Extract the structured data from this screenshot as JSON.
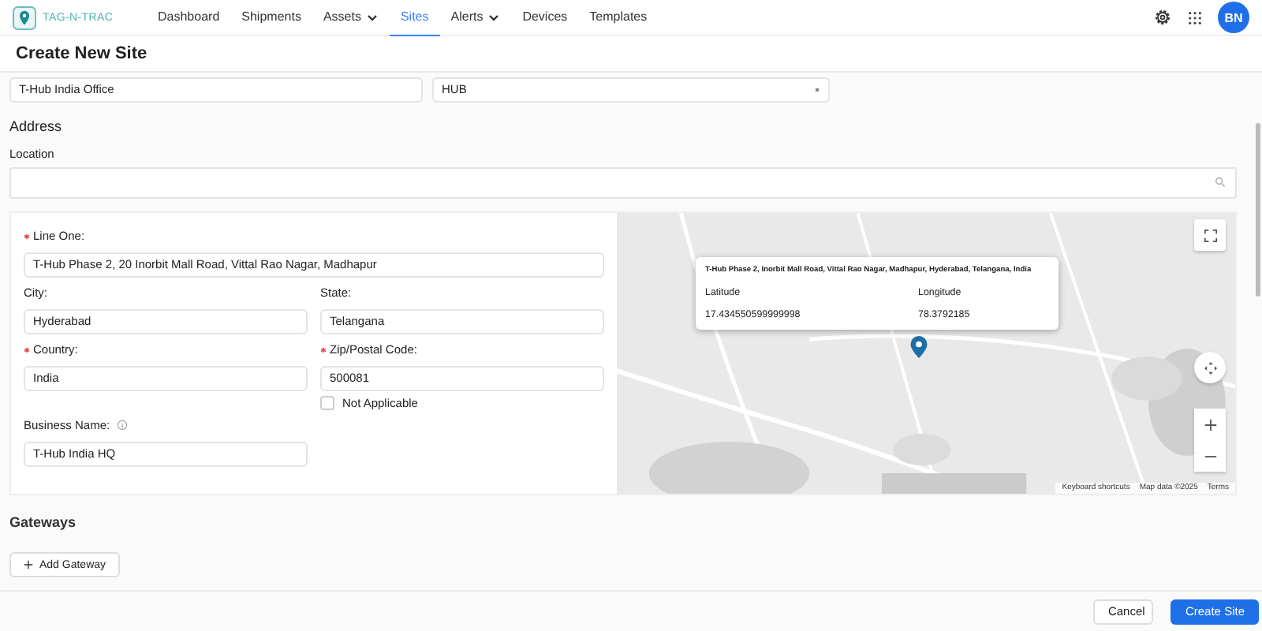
{
  "nav": {
    "brand": "TAG-N-TRAC",
    "items": [
      {
        "label": "Dashboard",
        "selected": false,
        "dropdown": false
      },
      {
        "label": "Shipments",
        "selected": false,
        "dropdown": false
      },
      {
        "label": "Assets",
        "selected": false,
        "dropdown": true
      },
      {
        "label": "Sites",
        "selected": true,
        "dropdown": false
      },
      {
        "label": "Alerts",
        "selected": false,
        "dropdown": true
      },
      {
        "label": "Devices",
        "selected": false,
        "dropdown": false
      },
      {
        "label": "Templates",
        "selected": false,
        "dropdown": false
      }
    ],
    "avatar": "BN"
  },
  "page_title": "Create New Site",
  "top_fields": [
    {
      "kind": "text",
      "value": "T-Hub India Office"
    },
    {
      "kind": "select",
      "value": "HUB"
    }
  ],
  "address_heading": "Address",
  "location": {
    "label": "Location"
  },
  "address_fields": [
    {
      "label": "Line One:",
      "required": true,
      "value": "T-Hub Phase 2, 20 Inorbit Mall Road, Vittal Rao Nagar, Madhapur",
      "wide": true
    },
    {
      "label": "City:",
      "required": false,
      "value": "Hyderabad",
      "wide": false
    },
    {
      "label": "State:",
      "required": false,
      "value": "Telangana",
      "wide": false
    },
    {
      "label": "Country:",
      "required": true,
      "value": "India",
      "wide": false
    },
    {
      "label": "Zip/Postal Code:",
      "required": true,
      "value": "500081",
      "wide": false
    }
  ],
  "not_applicable": {
    "label": "Not Applicable",
    "checked": false
  },
  "business_name": {
    "label": "Business Name:",
    "value": "T-Hub India HQ"
  },
  "map": {
    "popup": {
      "address": "T-Hub Phase 2, Inorbit Mall Road, Vittal Rao Nagar, Madhapur, Hyderabad, Telangana, India",
      "latitude_label": "Latitude",
      "latitude": "17.434550599999998",
      "longitude_label": "Longitude",
      "longitude": "78.3792185"
    },
    "footer": [
      "Keyboard shortcuts",
      "Map data ©2025",
      "Terms"
    ]
  },
  "gateways": {
    "heading": "Gateways",
    "add_button": "Add Gateway"
  },
  "footer": {
    "cancel": "Cancel",
    "submit": "Create Site"
  }
}
